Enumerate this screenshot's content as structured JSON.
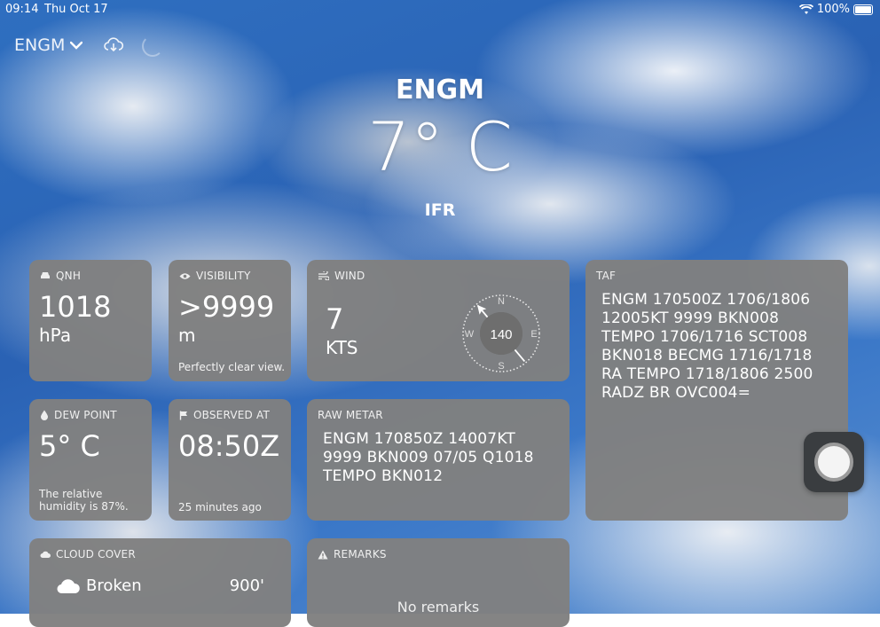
{
  "status_bar": {
    "time": "09:14",
    "date": "Thu Oct 17",
    "battery": "100%"
  },
  "header": {
    "station": "ENGM"
  },
  "hero": {
    "station": "ENGM",
    "temperature": "7° C",
    "flight_category": "IFR"
  },
  "cards": {
    "qnh": {
      "title": "QNH",
      "value": "1018",
      "unit": "hPa"
    },
    "visibility": {
      "title": "VISIBILITY",
      "value": ">9999",
      "unit": "m",
      "note": "Perfectly clear view."
    },
    "wind": {
      "title": "WIND",
      "speed": "7",
      "unit": "KTS",
      "direction": "140",
      "direction_deg": 140,
      "compass": {
        "n": "N",
        "e": "E",
        "s": "S",
        "w": "W"
      }
    },
    "taf": {
      "title": "TAF",
      "text": "ENGM 170500Z 1706/1806 12005KT 9999 BKN008 TEMPO 1706/1716 SCT008 BKN018 BECMG 1716/1718 RA TEMPO 1718/1806 2500 RADZ BR OVC004="
    },
    "dew_point": {
      "title": "DEW POINT",
      "value": "5° C",
      "note": "The relative humidity is 87%."
    },
    "observed_at": {
      "title": "OBSERVED AT",
      "value": "08:50Z",
      "note": "25 minutes ago"
    },
    "raw_metar": {
      "title": "RAW METAR",
      "text": "ENGM 170850Z 14007KT 9999 BKN009 07/05 Q1018 TEMPO BKN012"
    },
    "cloud_cover": {
      "title": "CLOUD COVER",
      "layer": "Broken",
      "altitude": "900'"
    },
    "remarks": {
      "title": "REMARKS",
      "text": "No remarks"
    }
  },
  "colors": {
    "card_bg": "#808080",
    "sky": "#2f6fc0"
  }
}
